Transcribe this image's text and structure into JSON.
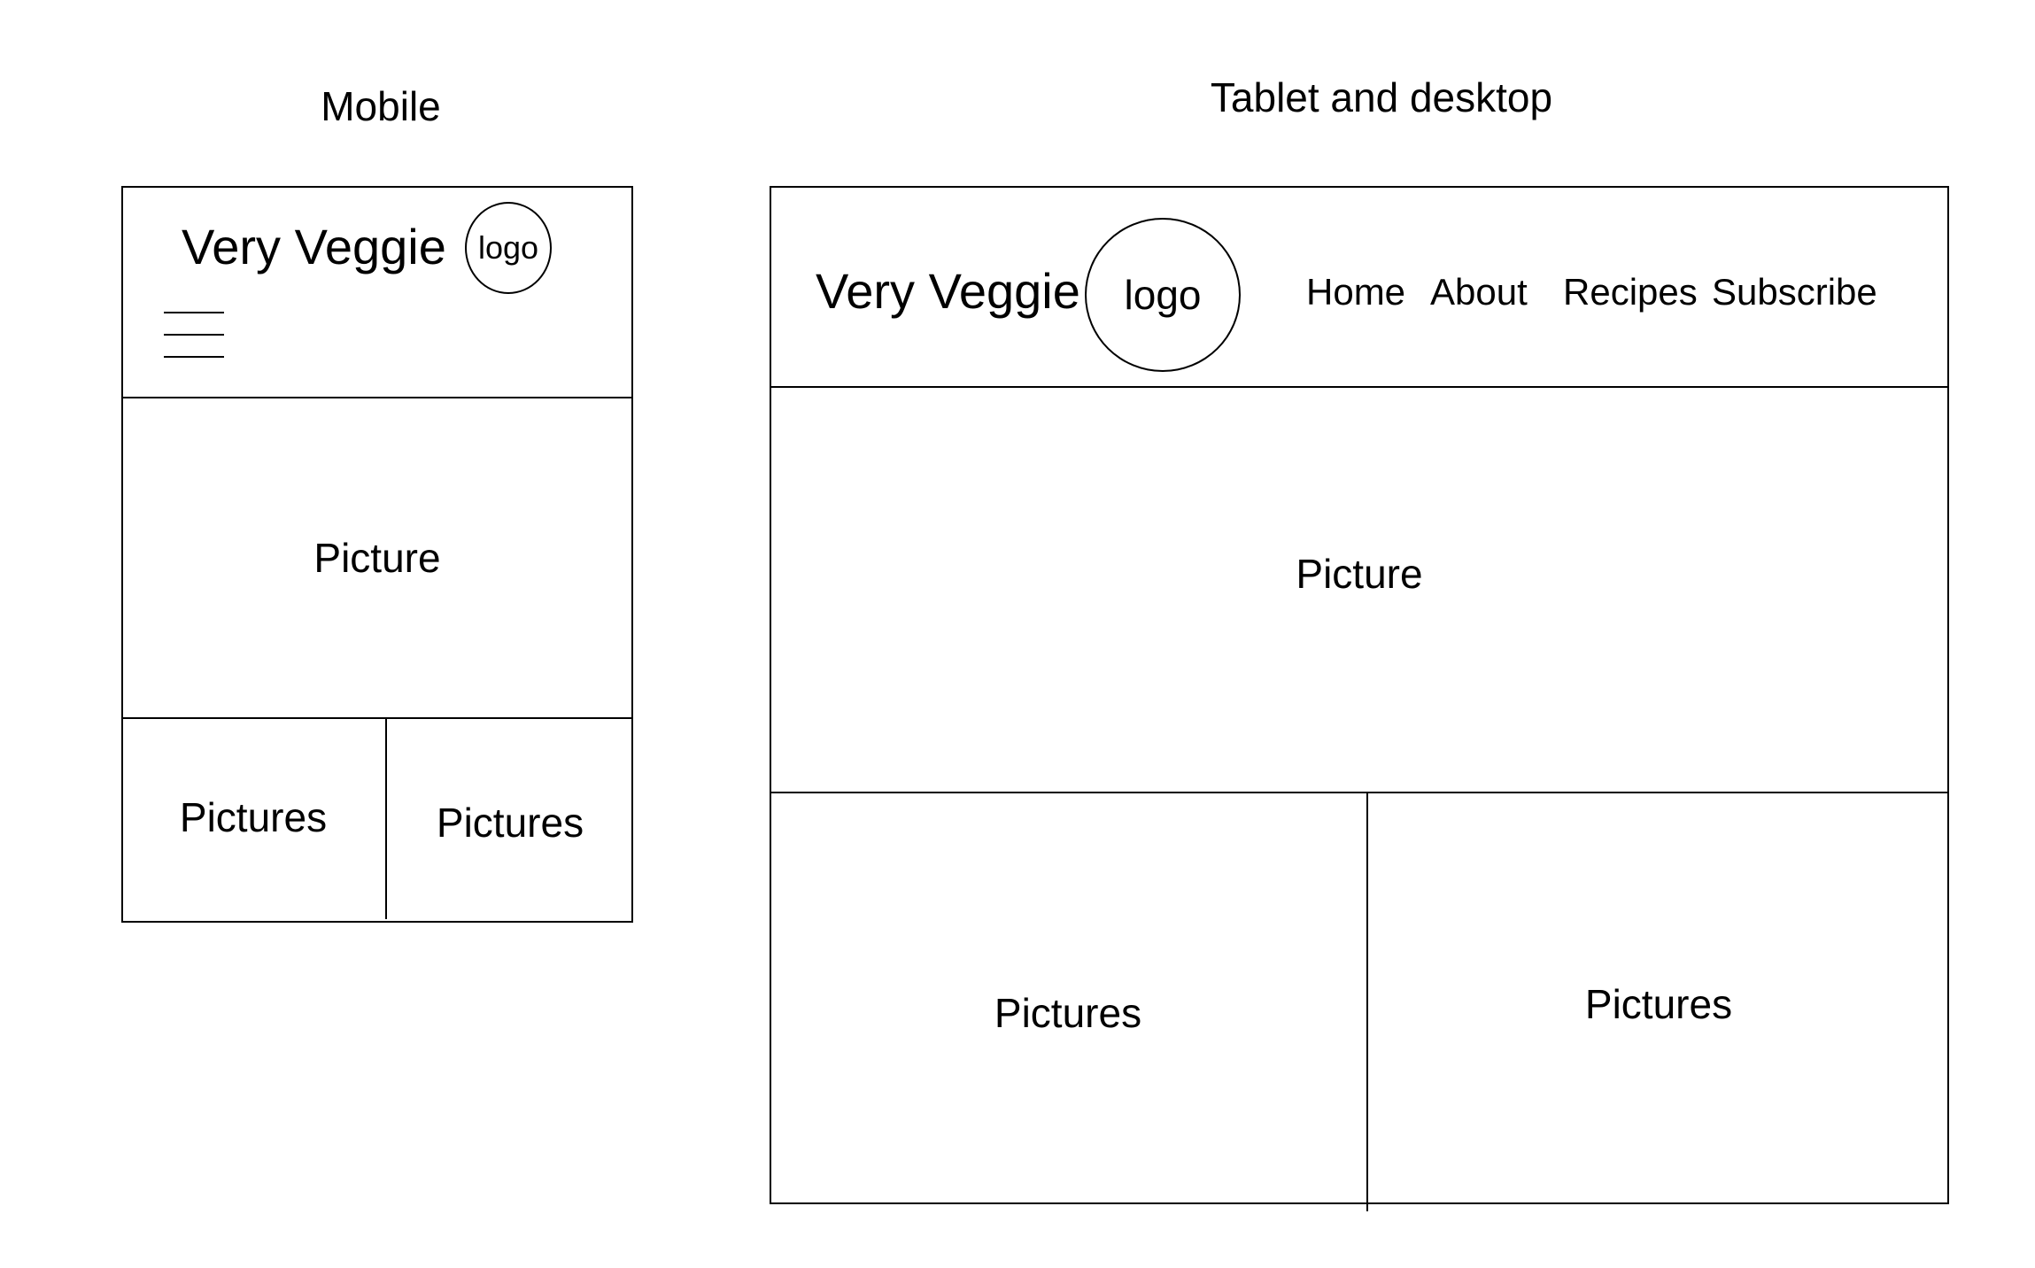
{
  "mobile": {
    "heading": "Mobile",
    "brand": "Very Veggie",
    "logo": "logo",
    "hero_label": "Picture",
    "tiles": [
      "Pictures",
      "Pictures"
    ]
  },
  "desktop": {
    "heading": "Tablet and desktop",
    "brand": "Very Veggie",
    "logo": "logo",
    "nav": [
      "Home",
      "About",
      "Recipes",
      "Subscribe"
    ],
    "hero_label": "Picture",
    "tiles": [
      "Pictures",
      "Pictures"
    ]
  }
}
